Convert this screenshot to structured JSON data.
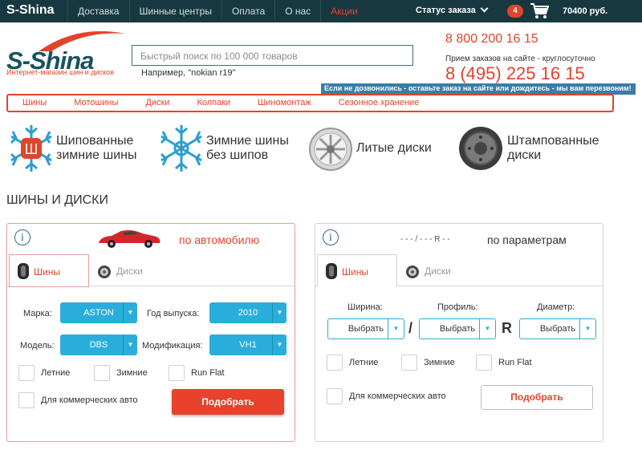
{
  "topbar": {
    "brand": "S-Shina",
    "nav": [
      "Доставка",
      "Шинные центры",
      "Оплата",
      "О нас",
      "Акции"
    ],
    "status": "Статус заказа",
    "cart_count": "4",
    "cart_sum": "70400 руб.",
    "icons": [
      "chevron-down-icon",
      "cart-icon"
    ]
  },
  "logo": {
    "word": "S-Shina",
    "tagline": "Интернет-магазин шин и дисков"
  },
  "search": {
    "placeholder": "Быстрый поиск по 100 000 товаров",
    "example": "Например, \"nokian r19\""
  },
  "contacts": {
    "phone1": "8 800 200 16 15",
    "hours": "Прием заказов на сайте - круглосуточно",
    "phone2": "8 (495) 225 16 15",
    "note": "Если не дозвонились - оставьте заказ на сайте или дождитесь - мы вам перезвоним!"
  },
  "catnav": [
    "Шины",
    "Мотошины",
    "Диски",
    "Колпаки",
    "Шиномонтаж",
    "Сезонное хранение"
  ],
  "categories": [
    {
      "line1": "Шипованные",
      "line2": "зимние шины",
      "icon": "snowflake-stud-icon"
    },
    {
      "line1": "Зимние шины",
      "line2": "без шипов",
      "icon": "snowflake-icon"
    },
    {
      "line1": "Литые диски",
      "line2": "",
      "icon": "alloy-wheel-icon"
    },
    {
      "line1": "Штампованные",
      "line2": "диски",
      "icon": "steel-wheel-icon"
    }
  ],
  "section_title": "ШИНЫ И ДИСКИ",
  "by_car": {
    "title": "по автомобилю",
    "tab_tires": "Шины",
    "tab_disks": "Диски",
    "make_label": "Марка:",
    "make_value": "ASTON",
    "year_label": "Год выпуска:",
    "year_value": "2010",
    "model_label": "Модель:",
    "model_value": "DBS",
    "mod_label": "Модификация:",
    "mod_value": "VH1",
    "summer": "Летние",
    "winter": "Зимние",
    "runflat": "Run Flat",
    "commercial": "Для коммерческих авто",
    "button": "Подобрать"
  },
  "by_params": {
    "title": "по параметрам",
    "size_hint": "- - - / - - - R - -",
    "tab_tires": "Шины",
    "tab_disks": "Диски",
    "width_label": "Ширина:",
    "profile_label": "Профиль:",
    "diameter_label": "Диаметр:",
    "select_value": "Выбрать",
    "slash": "/",
    "r": "R",
    "summer": "Летние",
    "winter": "Зимние",
    "runflat": "Run Flat",
    "commercial": "Для коммерческих авто",
    "button": "Подобрать"
  },
  "colors": {
    "accent": "#e2442b",
    "topbar": "#173840",
    "select_blue": "#29aedb",
    "logo_blue": "#18525f"
  }
}
